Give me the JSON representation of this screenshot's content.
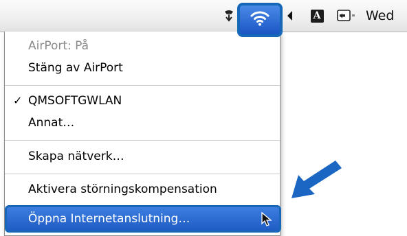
{
  "menubar": {
    "script_icon": "script-menu-icon",
    "wifi_icon": "airport-wifi-icon",
    "volume_icon": "volume-icon",
    "input_icon": "input-menu-icon",
    "input_letter": "A",
    "display_icon": "display-mirror-icon",
    "clock": "Wed"
  },
  "menu": {
    "status": "AirPort: På",
    "turn_off": "Stäng av AirPort",
    "network_check": "✓",
    "network": "QMSOFTGWLAN",
    "other": "Annat…",
    "create_network": "Skapa nätverk…",
    "interference": "Aktivera störningskompensation",
    "open_connect": "Öppna Internetanslutning…"
  },
  "colors": {
    "highlight": "#2f6fd8",
    "callout": "#1767b8"
  }
}
